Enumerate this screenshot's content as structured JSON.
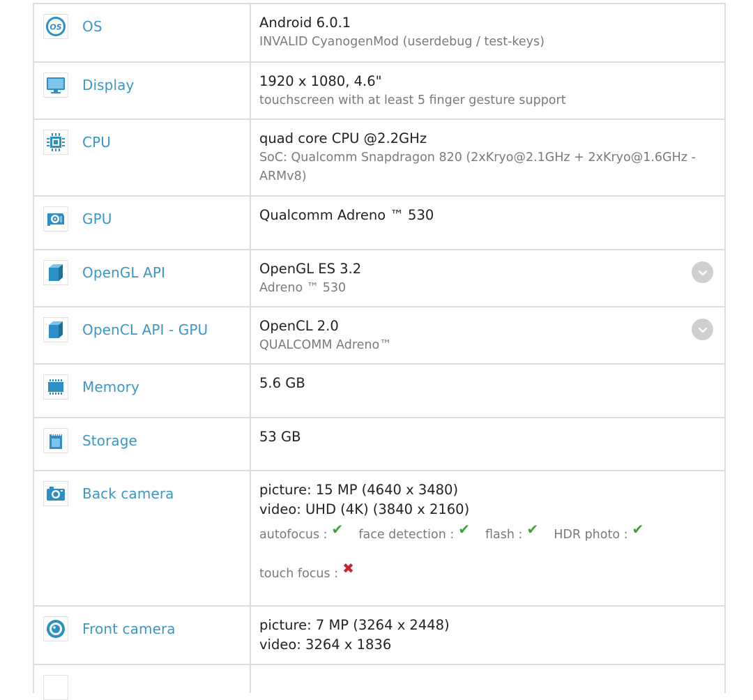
{
  "rows": [
    {
      "icon": "os-icon",
      "label": "OS",
      "value": "Android 6.0.1",
      "detail": "INVALID CyanogenMod (userdebug / test-keys)"
    },
    {
      "icon": "display-icon",
      "label": "Display",
      "value": "1920 x 1080, 4.6\"",
      "detail": "touchscreen with at least 5 finger gesture support"
    },
    {
      "icon": "cpu-icon",
      "label": "CPU",
      "value": "quad core CPU @2.2GHz",
      "detail": "SoC: Qualcomm Snapdragon 820 (2xKryo@2.1GHz + 2xKryo@1.6GHz - ARMv8)"
    },
    {
      "icon": "gpu-icon",
      "label": "GPU",
      "value": "Qualcomm Adreno ™ 530"
    },
    {
      "icon": "opengl-icon",
      "label": "OpenGL API",
      "value": "OpenGL ES 3.2",
      "detail": "Adreno ™ 530",
      "expandable": true
    },
    {
      "icon": "opencl-icon",
      "label": "OpenCL API - GPU",
      "value": "OpenCL 2.0",
      "detail": "QUALCOMM Adreno™",
      "expandable": true
    },
    {
      "icon": "memory-icon",
      "label": "Memory",
      "value": "5.6 GB"
    },
    {
      "icon": "storage-icon",
      "label": "Storage",
      "value": "53 GB"
    },
    {
      "icon": "camera-icon",
      "label": "Back camera",
      "value": "picture: 15 MP (4640 x 3480)",
      "value2": "video: UHD (4K) (3840 x 2160)",
      "features": [
        {
          "label": "autofocus :",
          "supported": true
        },
        {
          "label": "face detection :",
          "supported": true
        },
        {
          "label": "flash :",
          "supported": true
        },
        {
          "label": "HDR photo :",
          "supported": true
        },
        {
          "label": "touch focus :",
          "supported": false
        }
      ]
    },
    {
      "icon": "front-camera-icon",
      "label": "Front camera",
      "value": "picture: 7 MP (3264 x 2448)",
      "value2": "video: 3264 x 1836"
    }
  ],
  "marks": {
    "check": "✔",
    "cross": "✖"
  },
  "colors": {
    "label": "#3c97c6",
    "icon": "#2c8fc6",
    "check": "#3da33a",
    "cross": "#c9262a"
  }
}
